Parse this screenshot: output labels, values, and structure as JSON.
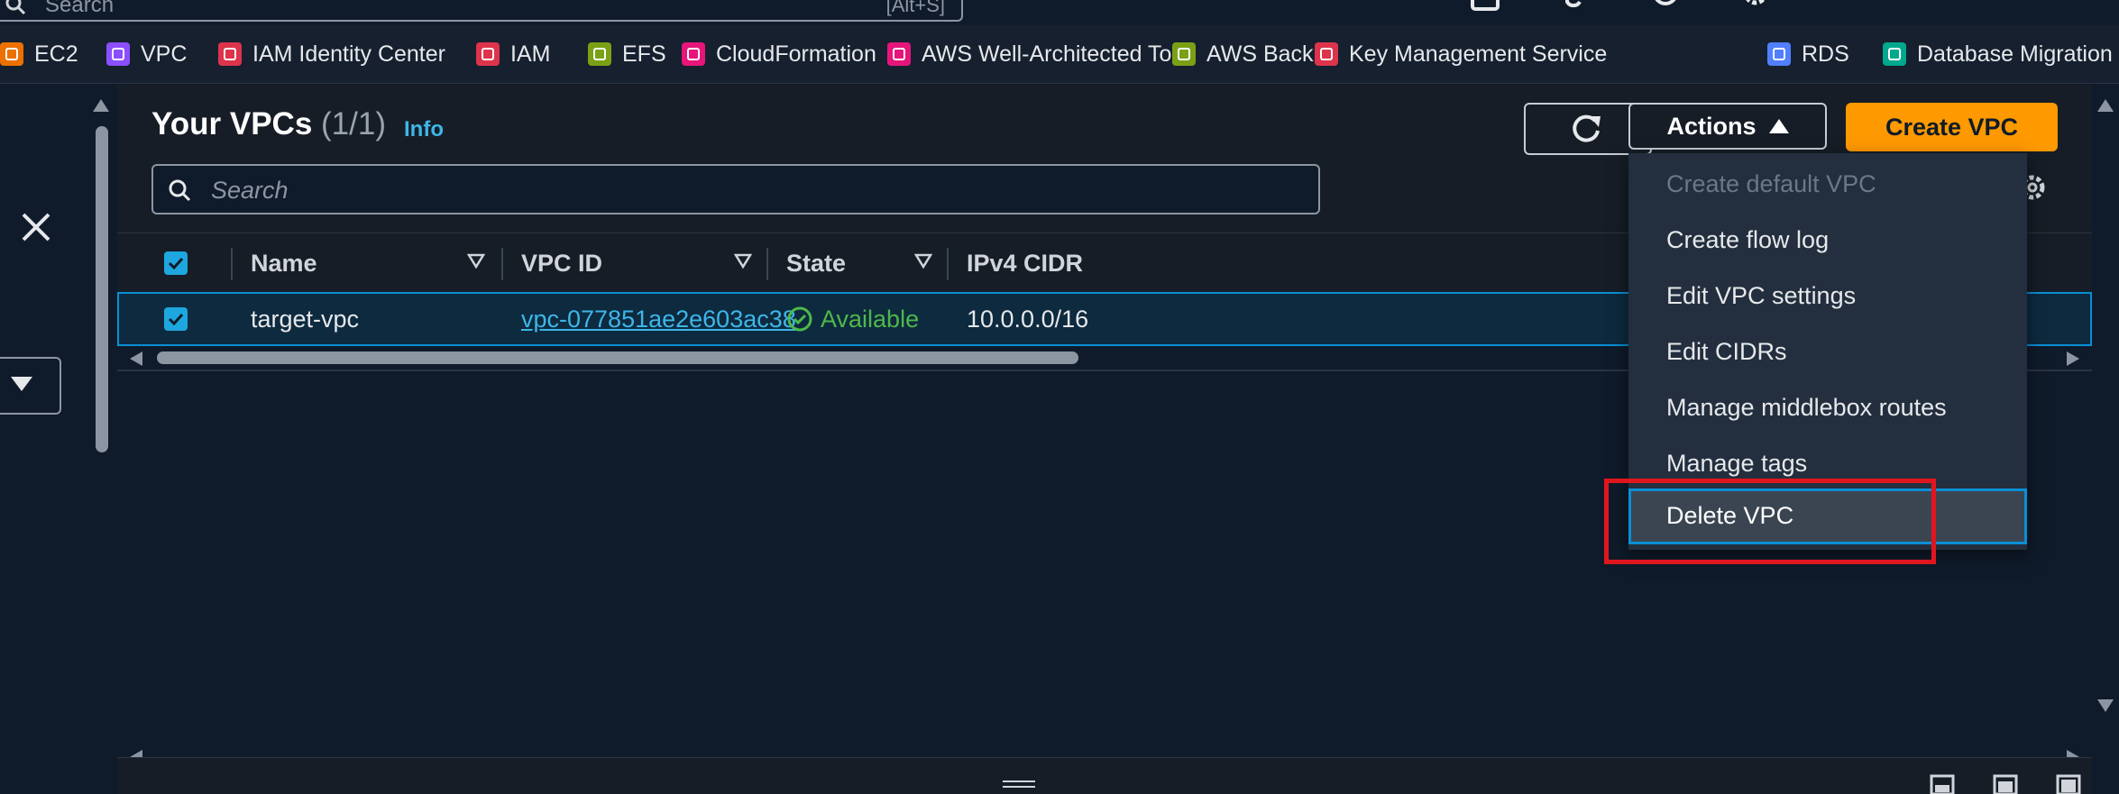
{
  "top": {
    "search_placeholder": "Search",
    "search_shortcut": "[Alt+S]"
  },
  "favorites": [
    {
      "label": "EC2",
      "color": "#ed7100"
    },
    {
      "label": "VPC",
      "color": "#8c4fff"
    },
    {
      "label": "IAM Identity Center",
      "color": "#dd344c"
    },
    {
      "label": "IAM",
      "color": "#dd344c"
    },
    {
      "label": "EFS",
      "color": "#7aa116"
    },
    {
      "label": "CloudFormation",
      "color": "#e7157b"
    },
    {
      "label": "AWS Well-Architected Tool",
      "color": "#e7157b"
    },
    {
      "label": "AWS Backup",
      "color": "#7aa116"
    },
    {
      "label": "Key Management Service",
      "color": "#dd344c"
    },
    {
      "label": "RDS",
      "color": "#527fff"
    },
    {
      "label": "Database Migration S",
      "color": "#01a88d"
    }
  ],
  "header": {
    "title": "Your VPCs",
    "count": "(1/1)",
    "info": "Info"
  },
  "buttons": {
    "actions": "Actions",
    "create": "Create VPC"
  },
  "search": {
    "placeholder": "Search"
  },
  "columns": {
    "name": "Name",
    "vpc_id": "VPC ID",
    "state": "State",
    "ipv4": "IPv4 CIDR"
  },
  "row": {
    "name": "target-vpc",
    "vpc_id": "vpc-077851ae2e603ac38",
    "state": "Available",
    "ipv4": "10.0.0.0/16"
  },
  "menu": {
    "items": [
      {
        "label": "Create default VPC",
        "disabled": true
      },
      {
        "label": "Create flow log"
      },
      {
        "label": "Edit VPC settings"
      },
      {
        "label": "Edit CIDRs"
      },
      {
        "label": "Manage middlebox routes"
      },
      {
        "label": "Manage tags"
      }
    ],
    "highlighted": "Delete VPC"
  },
  "colors": {
    "accent": "#ff9900",
    "link": "#3eb6e8",
    "success": "#4fb84a",
    "highlight_border": "#0a8fd6",
    "annotation": "#e0161e"
  }
}
